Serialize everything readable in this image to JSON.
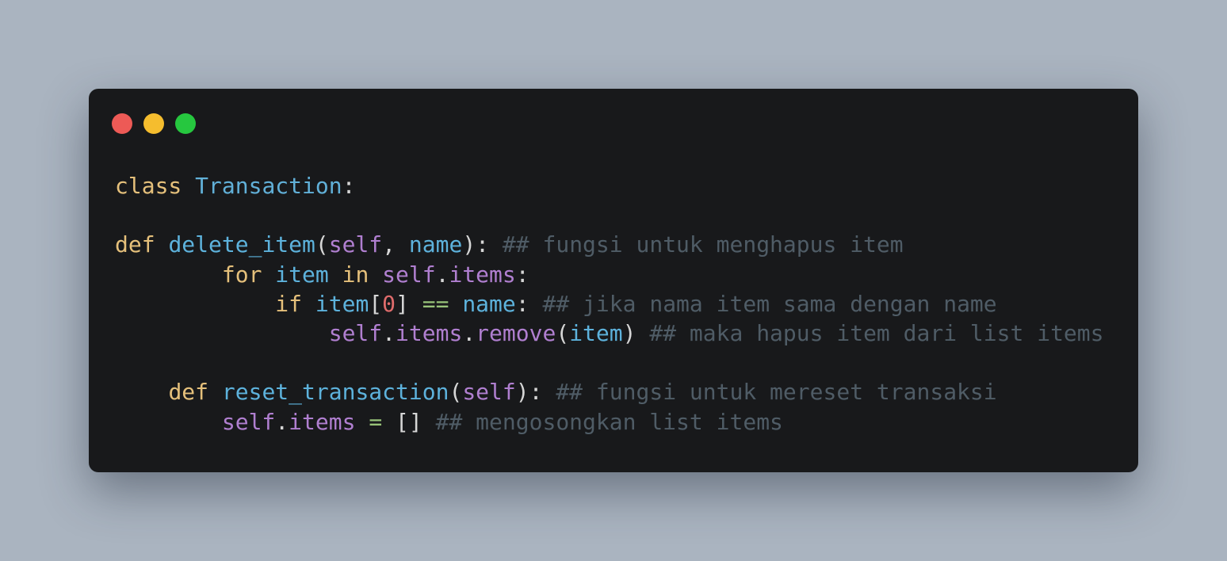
{
  "window": {
    "controls": [
      {
        "name": "close",
        "color": "#ed5a56"
      },
      {
        "name": "minimize",
        "color": "#f5bd2e"
      },
      {
        "name": "maximize",
        "color": "#26c73f"
      }
    ]
  },
  "code": {
    "lines": [
      [
        {
          "t": "class",
          "k": "kw"
        },
        {
          "t": " ",
          "k": "p"
        },
        {
          "t": "Transaction",
          "k": "cls"
        },
        {
          "t": ":",
          "k": "p"
        }
      ],
      [],
      [
        {
          "t": "def",
          "k": "kw"
        },
        {
          "t": " ",
          "k": "p"
        },
        {
          "t": "delete_item",
          "k": "fn"
        },
        {
          "t": "(",
          "k": "p"
        },
        {
          "t": "self",
          "k": "self"
        },
        {
          "t": ", ",
          "k": "p"
        },
        {
          "t": "name",
          "k": "var"
        },
        {
          "t": "): ",
          "k": "p"
        },
        {
          "t": "## fungsi untuk menghapus item",
          "k": "cm"
        }
      ],
      [
        {
          "t": "        ",
          "k": "p"
        },
        {
          "t": "for",
          "k": "kw"
        },
        {
          "t": " ",
          "k": "p"
        },
        {
          "t": "item",
          "k": "var"
        },
        {
          "t": " ",
          "k": "p"
        },
        {
          "t": "in",
          "k": "kw"
        },
        {
          "t": " ",
          "k": "p"
        },
        {
          "t": "self",
          "k": "self"
        },
        {
          "t": ".",
          "k": "p"
        },
        {
          "t": "items",
          "k": "self"
        },
        {
          "t": ":",
          "k": "p"
        }
      ],
      [
        {
          "t": "            ",
          "k": "p"
        },
        {
          "t": "if",
          "k": "kw"
        },
        {
          "t": " ",
          "k": "p"
        },
        {
          "t": "item",
          "k": "var"
        },
        {
          "t": "[",
          "k": "p"
        },
        {
          "t": "0",
          "k": "num"
        },
        {
          "t": "] ",
          "k": "p"
        },
        {
          "t": "==",
          "k": "op"
        },
        {
          "t": " ",
          "k": "p"
        },
        {
          "t": "name",
          "k": "var"
        },
        {
          "t": ": ",
          "k": "p"
        },
        {
          "t": "## jika nama item sama dengan name",
          "k": "cm"
        }
      ],
      [
        {
          "t": "                ",
          "k": "p"
        },
        {
          "t": "self",
          "k": "self"
        },
        {
          "t": ".",
          "k": "p"
        },
        {
          "t": "items",
          "k": "self"
        },
        {
          "t": ".",
          "k": "p"
        },
        {
          "t": "remove",
          "k": "self"
        },
        {
          "t": "(",
          "k": "p"
        },
        {
          "t": "item",
          "k": "var"
        },
        {
          "t": ") ",
          "k": "p"
        },
        {
          "t": "## maka hapus item dari list items",
          "k": "cm"
        }
      ],
      [],
      [
        {
          "t": "    ",
          "k": "p"
        },
        {
          "t": "def",
          "k": "kw"
        },
        {
          "t": " ",
          "k": "p"
        },
        {
          "t": "reset_transaction",
          "k": "fn"
        },
        {
          "t": "(",
          "k": "p"
        },
        {
          "t": "self",
          "k": "self"
        },
        {
          "t": "): ",
          "k": "p"
        },
        {
          "t": "## fungsi untuk mereset transaksi",
          "k": "cm"
        }
      ],
      [
        {
          "t": "        ",
          "k": "p"
        },
        {
          "t": "self",
          "k": "self"
        },
        {
          "t": ".",
          "k": "p"
        },
        {
          "t": "items",
          "k": "self"
        },
        {
          "t": " ",
          "k": "p"
        },
        {
          "t": "=",
          "k": "op"
        },
        {
          "t": " ",
          "k": "p"
        },
        {
          "t": "[]",
          "k": "p"
        },
        {
          "t": " ",
          "k": "p"
        },
        {
          "t": "## mengosongkan list items",
          "k": "cm"
        }
      ]
    ]
  }
}
